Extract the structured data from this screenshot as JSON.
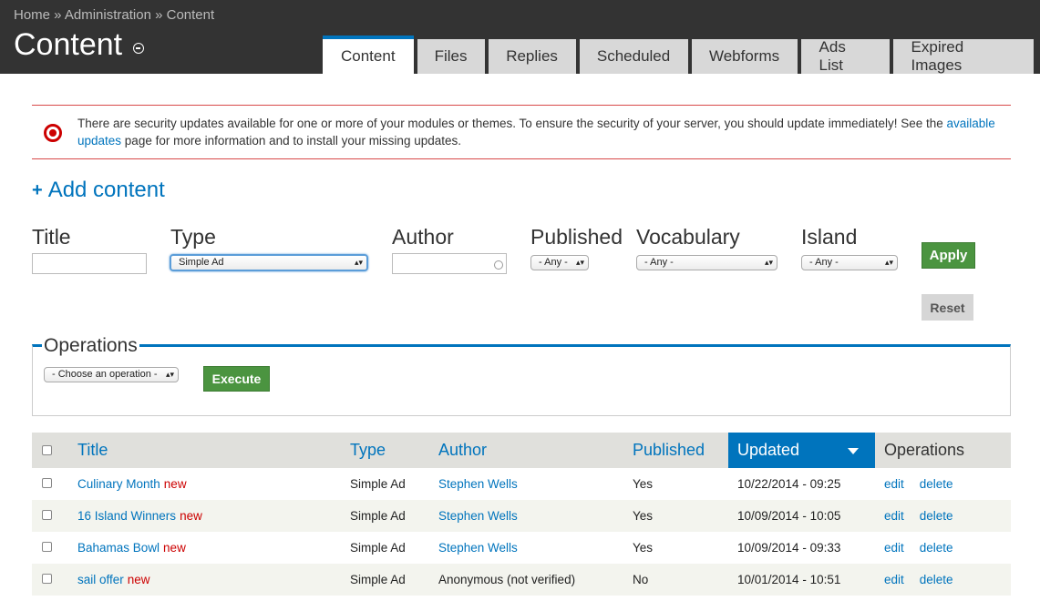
{
  "breadcrumb": {
    "home": "Home",
    "sep": " » ",
    "admin": "Administration",
    "current": "Content"
  },
  "page": {
    "title": "Content"
  },
  "tabs": [
    "Content",
    "Files",
    "Replies",
    "Scheduled",
    "Webforms",
    "Ads List",
    "Expired Images"
  ],
  "alert": {
    "text_before": "There are security updates available for one or more of your modules or themes. To ensure the security of your server, you should update immediately! See the ",
    "link_1": "available",
    "link_2": "updates",
    "text_after": " page for more information and to install your missing updates.",
    "accent": "#d84949"
  },
  "add_content": {
    "label": "Add content",
    "icon": "plus-icon"
  },
  "filters": {
    "title_label": "Title",
    "title_value": "",
    "type_label": "Type",
    "type_value": "Simple Ad",
    "author_label": "Author",
    "author_value": "",
    "published_label": "Published",
    "published_value": "- Any -",
    "vocabulary_label": "Vocabulary",
    "vocabulary_value": "- Any -",
    "island_label": "Island",
    "island_value": "- Any -",
    "apply": "Apply",
    "reset": "Reset"
  },
  "operations": {
    "legend": "Operations",
    "select_value": "- Choose an operation -",
    "execute": "Execute"
  },
  "table": {
    "headers": {
      "title": "Title",
      "type": "Type",
      "author": "Author",
      "published": "Published",
      "updated": "Updated",
      "operations": "Operations"
    },
    "rows": [
      {
        "title": "Culinary Month",
        "flag": "new",
        "type": "Simple Ad",
        "author": "Stephen Wells",
        "published": "Yes",
        "updated": "10/22/2014 - 09:25",
        "edit": "edit",
        "delete": "delete"
      },
      {
        "title": "16 Island Winners",
        "flag": "new",
        "type": "Simple Ad",
        "author": "Stephen Wells",
        "published": "Yes",
        "updated": "10/09/2014 - 10:05",
        "edit": "edit",
        "delete": "delete"
      },
      {
        "title": "Bahamas Bowl",
        "flag": "new",
        "type": "Simple Ad",
        "author": "Stephen Wells",
        "published": "Yes",
        "updated": "10/09/2014 - 09:33",
        "edit": "edit",
        "delete": "delete"
      },
      {
        "title": "sail offer",
        "flag": "new",
        "type": "Simple Ad",
        "author": "Anonymous (not verified)",
        "published": "No",
        "updated": "10/01/2014 - 10:51",
        "edit": "edit",
        "delete": "delete"
      }
    ]
  },
  "colors": {
    "accent": "#0074bd",
    "green": "#4b9440",
    "topbar": "#333333"
  }
}
